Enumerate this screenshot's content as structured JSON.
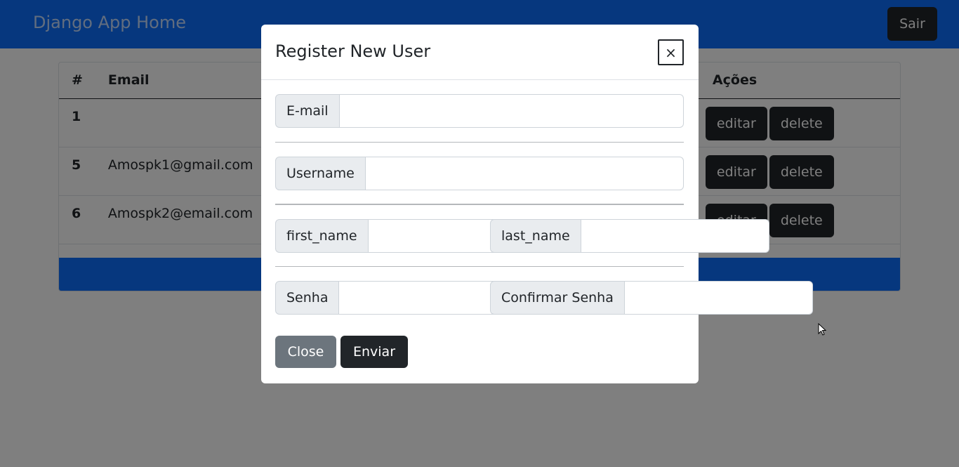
{
  "navbar": {
    "brand": "Django App Home",
    "logout_label": "Sair"
  },
  "table": {
    "headers": [
      "#",
      "Email",
      "Ações"
    ],
    "rows": [
      {
        "id": "1",
        "email": ""
      },
      {
        "id": "5",
        "email": "Amospk1@gmail.com"
      },
      {
        "id": "6",
        "email": "Amospk2@email.com"
      }
    ],
    "edit_label": "editar",
    "delete_label": "delete"
  },
  "modal": {
    "title": "Register New User",
    "close_symbol": "×",
    "fields": {
      "email": {
        "label": "E-mail",
        "value": ""
      },
      "username": {
        "label": "Username",
        "value": ""
      },
      "first_name": {
        "label": "first_name",
        "value": ""
      },
      "last_name": {
        "label": "last_name",
        "value": ""
      },
      "password": {
        "label": "Senha",
        "value": ""
      },
      "confirm_password": {
        "label": "Confirmar Senha",
        "value": ""
      }
    },
    "close_label": "Close",
    "submit_label": "Enviar"
  },
  "colors": {
    "primary": "#0d6efd",
    "dark": "#212529",
    "secondary": "#6c757d",
    "addon_bg": "#e9ecef"
  },
  "icons": {
    "close": "close-icon",
    "cursor": "mouse-pointer-icon"
  }
}
